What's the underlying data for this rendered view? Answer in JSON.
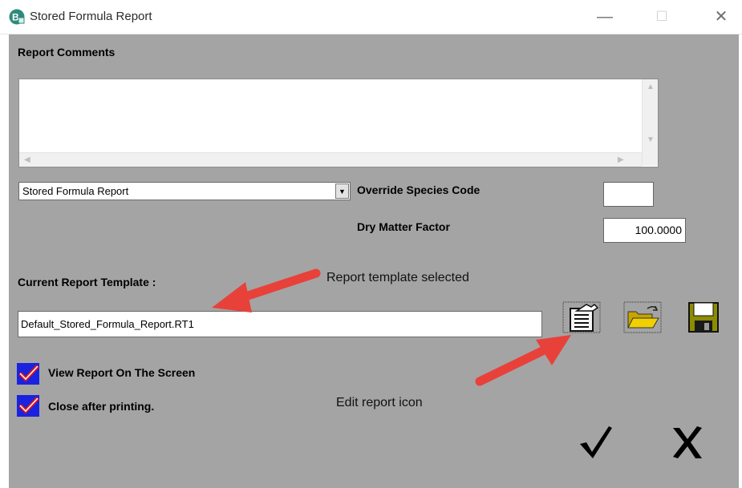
{
  "window": {
    "title": "Stored Formula Report",
    "controls": {
      "minimize": "—",
      "maximize": "☐",
      "close": "✕"
    }
  },
  "comments": {
    "label": "Report Comments",
    "value": ""
  },
  "report_type": {
    "selected": "Stored Formula Report"
  },
  "override_species": {
    "label": "Override Species Code",
    "value": ""
  },
  "dry_matter": {
    "label": "Dry Matter Factor",
    "value": "100.0000"
  },
  "template": {
    "label": "Current Report Template :",
    "value": "Default_Stored_Formula_Report.RT1"
  },
  "options": [
    {
      "label": "View Report On The Screen",
      "checked": true
    },
    {
      "label": "Close after printing.",
      "checked": true
    }
  ],
  "icons": {
    "edit": "edit-report-icon",
    "open": "open-folder-icon",
    "save": "save-disk-icon",
    "ok": "checkmark-icon",
    "cancel": "cancel-x-icon"
  },
  "annotations": {
    "template_selected": "Report template selected",
    "edit_icon": "Edit report icon"
  },
  "colors": {
    "dialog_bg": "#a4a4a4",
    "arrow": "#e8413a",
    "checkbox_blue": "#1a22e0",
    "checkbox_check": "#e01313"
  }
}
